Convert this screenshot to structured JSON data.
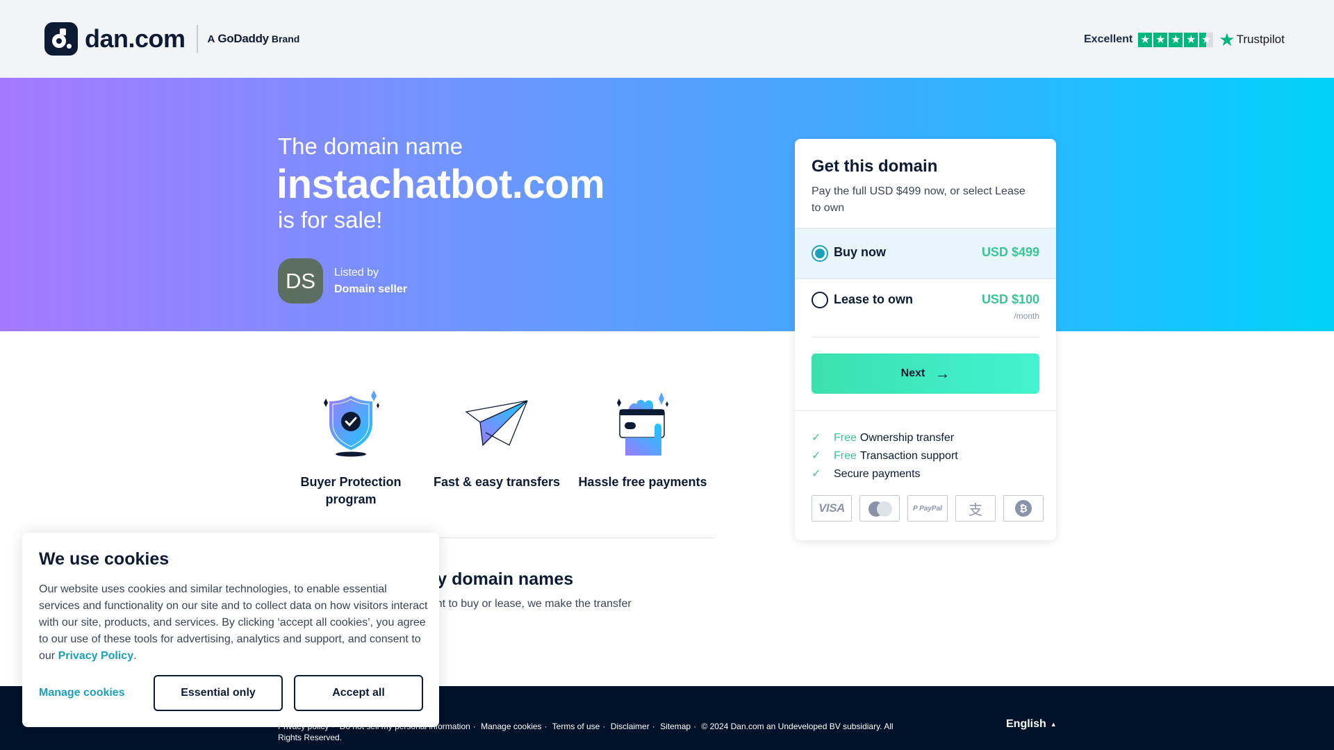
{
  "header": {
    "logo_text": "dan.com",
    "brand_prefix": "A",
    "brand_name": "GoDaddy",
    "brand_suffix": "Brand",
    "trustpilot": {
      "rating_label": "Excellent",
      "stars_filled": 4.5,
      "stars_total": 5,
      "logo_text": "Trustpilot",
      "star_color": "#00b67a"
    }
  },
  "hero": {
    "intro": "The domain name",
    "domain": "instachatbot.com",
    "sale_text": "is for sale!",
    "seller": {
      "initials": "DS",
      "label": "Listed by",
      "name": "Domain seller"
    }
  },
  "purchase_card": {
    "title": "Get this domain",
    "subtitle": "Pay the full USD $499 now, or select Lease to own",
    "options": [
      {
        "label": "Buy now",
        "price": "USD $499",
        "period": "",
        "selected": true
      },
      {
        "label": "Lease to own",
        "price": "USD $100",
        "period": "/month",
        "selected": false
      }
    ],
    "next_label": "Next",
    "perks": [
      {
        "highlight": "Free",
        "text": "Ownership transfer"
      },
      {
        "highlight": "Free",
        "text": "Transaction support"
      },
      {
        "highlight": "",
        "text": "Secure payments"
      }
    ],
    "payment_methods": [
      "VISA",
      "Mastercard",
      "PayPal",
      "Alipay",
      "Bitcoin"
    ],
    "payment_labels": {
      "visa": "VISA",
      "paypal": "P PayPal",
      "alipay": "支",
      "bitcoin": "₿"
    },
    "accent_color": "#3bc593"
  },
  "features": [
    {
      "icon": "shield-check-icon",
      "label": "Buyer Protection program"
    },
    {
      "icon": "paper-plane-icon",
      "label": "Fast & easy transfers"
    },
    {
      "icon": "card-payment-icon",
      "label": "Hassle free payments"
    }
  ],
  "easy_section": {
    "title": "The easy way to buy domain names",
    "text": "When you find a domain you want to buy or lease, we make the transfer"
  },
  "footer": {
    "links": [
      "Privacy policy",
      "Do not sell my personal information",
      "Manage cookies",
      "Terms of use",
      "Disclaimer",
      "Sitemap"
    ],
    "copyright": "© 2024 Dan.com an Undeveloped BV subsidiary. All Rights Reserved.",
    "language": "English"
  },
  "cookie_banner": {
    "title": "We use cookies",
    "text": "Our website uses cookies and similar technologies, to enable essential services and functionality on our site and to collect data on how visitors interact with our site, products, and services. By clicking ‘accept all cookies’, you agree to our use of these tools for advertising, analytics and support, and consent to our",
    "link_text": "Privacy Policy",
    "text_end": ".",
    "manage_label": "Manage cookies",
    "essential_label": "Essential only",
    "accept_label": "Accept all"
  }
}
